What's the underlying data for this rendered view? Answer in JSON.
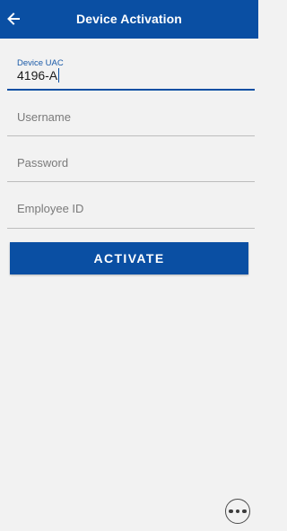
{
  "app_bar": {
    "title": "Device Activation",
    "back_icon": "arrow-left-icon",
    "background": "#0a4fa3"
  },
  "form": {
    "device_uac": {
      "label": "Device UAC",
      "value": "4196-A"
    },
    "username": {
      "placeholder": "Username"
    },
    "password": {
      "placeholder": "Password"
    },
    "employee_id": {
      "placeholder": "Employee ID"
    }
  },
  "activate_button": {
    "label": "ACTIVATE"
  },
  "more_button": {
    "icon": "more-horizontal-icon"
  },
  "colors": {
    "accent": "#0a4fa3",
    "background": "#f2f2f2"
  }
}
